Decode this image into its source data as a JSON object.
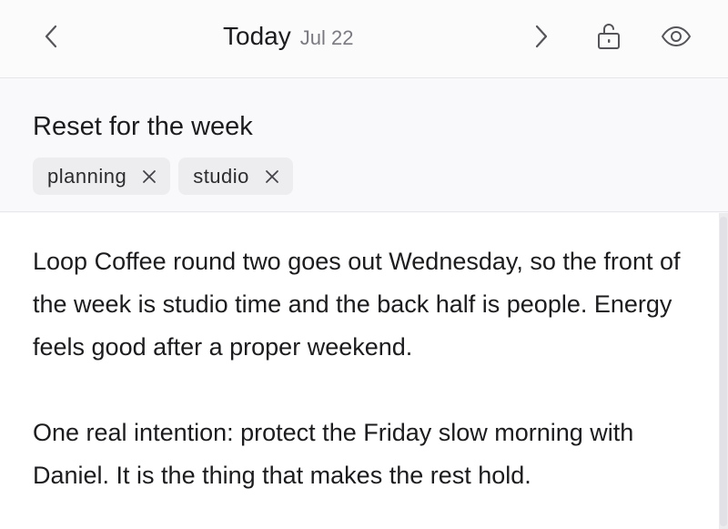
{
  "navbar": {
    "day_label": "Today",
    "date_label": "Jul 22",
    "back_icon": "chevron-left-icon",
    "forward_icon": "chevron-right-icon",
    "lock_icon": "unlocked-padlock-icon",
    "view_icon": "eye-icon"
  },
  "entry": {
    "title": "Reset for the week",
    "tags": [
      {
        "label": "planning"
      },
      {
        "label": "studio"
      }
    ],
    "paragraphs": [
      "Loop Coffee round two goes out Wednesday, so the front of the week is studio time and the back half is people. Energy feels good after a proper weekend.",
      "One real intention: protect the Friday slow morning with Daniel. It is the thing that makes the rest hold."
    ]
  },
  "colors": {
    "background": "#f9f9fb",
    "body_background": "#ffffff",
    "tag_background": "#ededf0",
    "text": "#1c1c1e",
    "muted_text": "#7a7a80"
  }
}
